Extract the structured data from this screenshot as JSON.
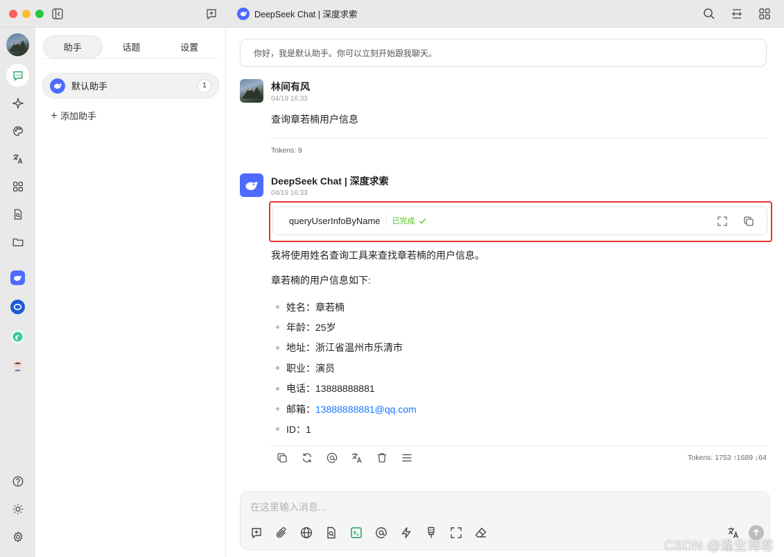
{
  "window": {
    "title": "DeepSeek Chat | 深度求索"
  },
  "panel": {
    "tabs": [
      {
        "label": "助手",
        "active": true
      },
      {
        "label": "话题",
        "active": false
      },
      {
        "label": "设置",
        "active": false
      }
    ],
    "assistant": {
      "name": "默认助手",
      "count": "1"
    },
    "add_label": "添加助手"
  },
  "rail": {
    "icons": [
      "avatar",
      "chat-icon",
      "sparkle-icon",
      "palette-icon",
      "translate-icon",
      "apps-icon",
      "doc-search-icon",
      "folder-icon"
    ],
    "models": [
      "deepseek",
      "blue-o",
      "green-swirl",
      "character"
    ],
    "bottom": [
      "help-icon",
      "brightness-icon",
      "settings-icon"
    ]
  },
  "chat": {
    "welcome": "你好，我是默认助手。你可以立刻开始跟我聊天。",
    "user_message": {
      "sender": "林间有风",
      "time": "04/19 16:33",
      "text": "查询章若楠用户信息",
      "tokens": "Tokens: 9"
    },
    "ai_message": {
      "sender": "DeepSeek Chat | 深度求索",
      "time": "04/19 16:33",
      "tool": {
        "name": "queryUserInfoByName",
        "status": "已完成"
      },
      "intro": "我将使用姓名查询工具来查找章若楠的用户信息。",
      "lead": "章若楠的用户信息如下:",
      "items": [
        "姓名：章若楠",
        "年龄：25岁",
        "地址：浙江省温州市乐清市",
        "职业：演员",
        "电话：13888888881"
      ],
      "email_label": "邮箱：",
      "email": "13888888881@qq.com",
      "id_item": "ID：1",
      "tokens": "Tokens: 1753 ↑1689 ↓64"
    },
    "composer": {
      "placeholder": "在这里输入消息..."
    }
  },
  "colors": {
    "accent_green": "#1aa260",
    "deepseek_blue": "#4d6bfe",
    "highlight_red": "#e3342f",
    "link_blue": "#1677ff"
  },
  "watermark": "CSDN @逢生博客"
}
